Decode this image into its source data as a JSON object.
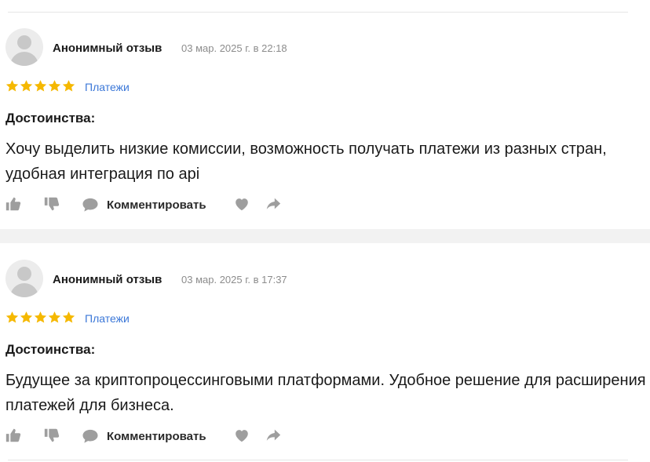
{
  "reviews": [
    {
      "author": "Анонимный отзыв",
      "date": "03 мар. 2025 г. в 22:18",
      "rating": 5,
      "category": "Платежи",
      "pros_title": "Достоинства:",
      "text": "Хочу выделить низкие комиссии, возможность получать платежи из разных стран, удобная интеграция по api",
      "comment_label": "Комментировать"
    },
    {
      "author": "Анонимный отзыв",
      "date": "03 мар. 2025 г. в 17:37",
      "rating": 5,
      "category": "Платежи",
      "pros_title": "Достоинства:",
      "text": "Будущее за криптопроцессинговыми платформами. Удобное решение для расширения платежей для бизнеса.",
      "comment_label": "Комментировать"
    }
  ],
  "colors": {
    "star": "#f5b800",
    "category_link": "#3c78d8",
    "icon_gray": "#9e9e9e",
    "separator": "#f2f2f2"
  },
  "icons": [
    "avatar-placeholder",
    "star-icon",
    "thumbs-up-icon",
    "thumbs-down-icon",
    "comment-icon",
    "heart-icon",
    "share-icon"
  ]
}
